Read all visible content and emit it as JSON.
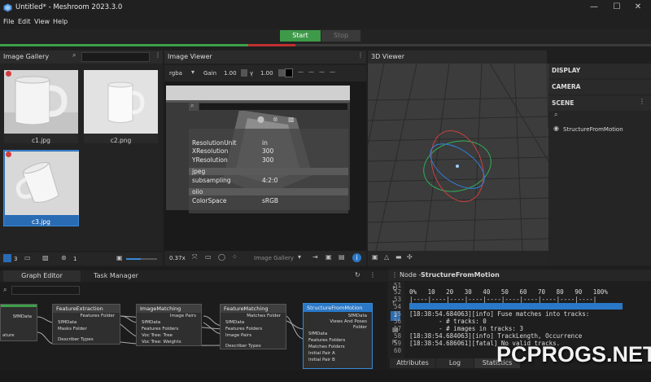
{
  "window": {
    "title": "Untitled* - Meshroom 2023.3.0",
    "minimize": "—",
    "maximize": "☐",
    "close": "✕"
  },
  "menu": [
    "File",
    "Edit",
    "View",
    "Help"
  ],
  "toolbar": {
    "start_label": "Start",
    "stop_label": "Stop"
  },
  "gallery": {
    "title": "Image Gallery",
    "images": [
      {
        "name": "c1.jpg"
      },
      {
        "name": "c2.png"
      },
      {
        "name": "c3.jpg"
      }
    ],
    "count_images": "3",
    "count_other": "1"
  },
  "viewer": {
    "title": "Image Viewer",
    "channel": "rgba",
    "gain_label": "Gain",
    "gain_value": "1.00",
    "gamma_label": "γ",
    "gamma_value": "1.00",
    "zoom": "0.37x",
    "source_label": "Image Gallery",
    "metadata": [
      {
        "k": "ResolutionUnit",
        "v": "in"
      },
      {
        "k": "XResolution",
        "v": "300"
      },
      {
        "k": "YResolution",
        "v": "300"
      },
      {
        "k": "jpeg",
        "v": ""
      },
      {
        "k": "subsampling",
        "v": "4:2:0"
      },
      {
        "k": "oiio",
        "v": ""
      },
      {
        "k": "ColorSpace",
        "v": "sRGB"
      }
    ]
  },
  "viewer3d": {
    "title": "3D Viewer",
    "sections": {
      "display": "DISPLAY",
      "camera": "CAMERA",
      "scene": "SCENE"
    },
    "scene_item": "StructureFromMotion"
  },
  "graph": {
    "tabs": [
      "Graph Editor",
      "Task Manager"
    ],
    "nodes": [
      {
        "title": "FeatureExtraction",
        "ports_in": [
          "SfMData",
          "Masks Folder",
          "Describer Types"
        ],
        "port_out": "Features Folder"
      },
      {
        "title": "ImageMatching",
        "ports_in": [
          "SfMData",
          "Features Folders",
          "Voc Tree: Tree",
          "Voc Tree: Weights"
        ],
        "port_out": "Image Pairs"
      },
      {
        "title": "FeatureMatching",
        "ports_in": [
          "SfMData",
          "Features Folders",
          "Image Pairs",
          "Describer Types"
        ],
        "port_out": "Matches Folder"
      },
      {
        "title": "StructureFromMotion",
        "ports_in": [
          "SfMData",
          "Features Folders",
          "Matches Folders",
          "Initial Pair A",
          "Initial Pair B"
        ],
        "ports_out": [
          "SfMData",
          "Views And Poses",
          "Folder"
        ]
      }
    ],
    "left_node_port": "SfMData",
    "left_node_label": "ature"
  },
  "nodepanel": {
    "prefix": "Node - ",
    "node_name": "StructureFromMotion",
    "log_lines": [
      {
        "n": "52",
        "t": "0%   10   20   30   40   50   60   70   80   90   100%"
      },
      {
        "n": "53",
        "t": "|----|----|----|----|----|----|----|----|----|----|"
      },
      {
        "n": "54",
        "t": ""
      },
      {
        "n": "55",
        "t": "[18:38:54.684063][info] Fuse matches into tracks:"
      },
      {
        "n": "56",
        "t": "        - # tracks: 0"
      },
      {
        "n": "57",
        "t": "        - # images in tracks: 3"
      },
      {
        "n": "58",
        "t": "[18:38:54.684063][info] TrackLength, Occurrence"
      },
      {
        "n": "59",
        "t": "[18:38:54.686061][fatal] No valid tracks."
      },
      {
        "n": "60",
        "t": ""
      }
    ],
    "partial_top": "51",
    "tabs": [
      "Attributes",
      "Log",
      "Statistics"
    ]
  },
  "watermark": "PCPROGS.NET",
  "colors": {
    "accent": "#3da048",
    "error": "#c03030",
    "selection": "#2a6cb4",
    "log_bar": "#2a78c8"
  }
}
